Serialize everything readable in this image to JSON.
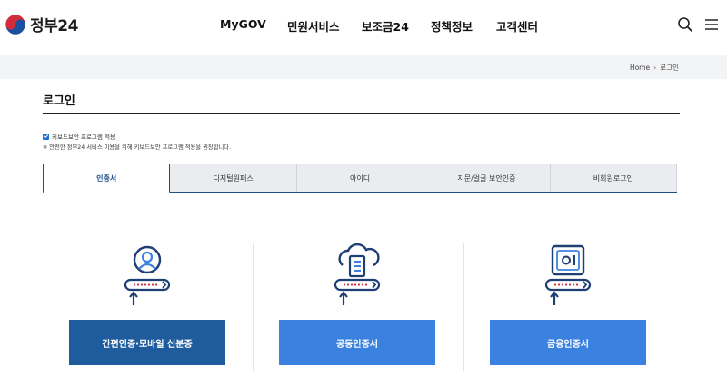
{
  "header": {
    "logo_text": "정부24",
    "nav": [
      {
        "label": "MyGOV"
      },
      {
        "label": "민원서비스"
      },
      {
        "label": "보조금24"
      },
      {
        "label": "정책정보"
      },
      {
        "label": "고객센터"
      }
    ],
    "icons": [
      "search-icon",
      "menu-icon"
    ]
  },
  "breadcrumb": {
    "home": "Home",
    "separator": "›",
    "current": "로그인"
  },
  "page": {
    "title": "로그인"
  },
  "security": {
    "checkbox_label": "키보드보안 프로그램 적용",
    "checked": true,
    "note": "※ 안전한 정부24 서비스 이용을 위해 키보드보안 프로그램 적용을 권장합니다."
  },
  "tabs": [
    {
      "label": "인증서",
      "active": true
    },
    {
      "label": "디지털원패스",
      "active": false
    },
    {
      "label": "아이디",
      "active": false
    },
    {
      "label": "지문/얼굴 보안인증",
      "active": false
    },
    {
      "label": "비회원로그인",
      "active": false
    }
  ],
  "cards": [
    {
      "label": "간편인증·모바일 신분증",
      "icon": "person-card-icon",
      "color": "#1f5c9e"
    },
    {
      "label": "공동인증서",
      "icon": "cloud-server-card-icon",
      "color": "#3b82e0"
    },
    {
      "label": "금융인증서",
      "icon": "safe-card-icon",
      "color": "#3b82e0"
    }
  ],
  "colors": {
    "brand_navy": "#1d4f8b",
    "primary_blue": "#3b82e0",
    "dark_blue": "#1f5c9e",
    "logo_red": "#d12c3a",
    "logo_blue": "#1b4fa0"
  }
}
